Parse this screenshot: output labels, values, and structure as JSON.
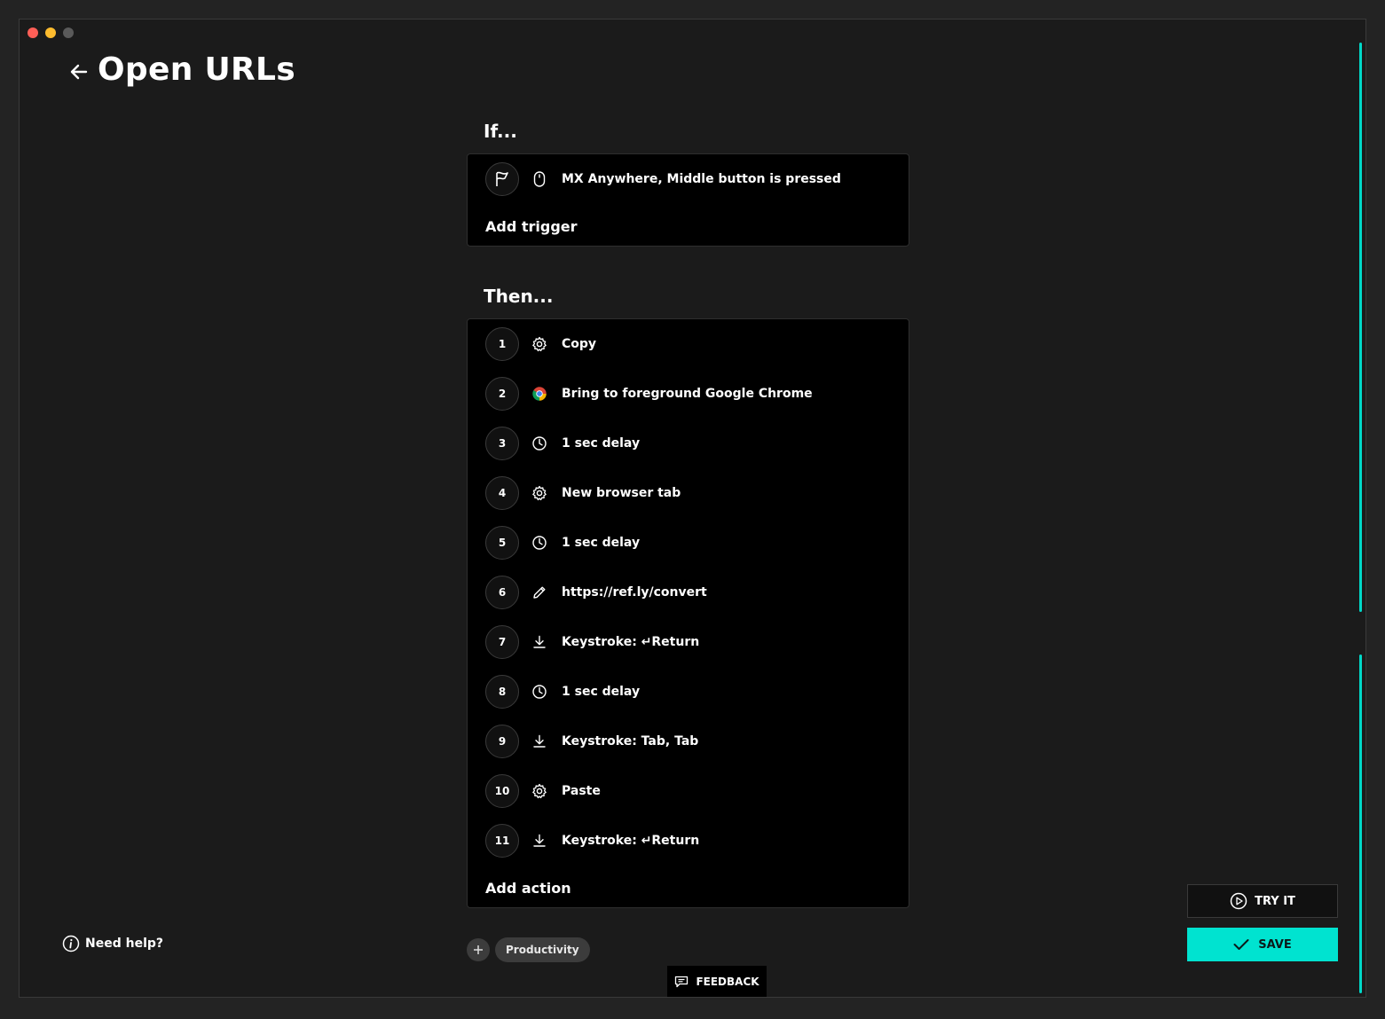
{
  "header": {
    "title": "Open URLs"
  },
  "if_section": {
    "label": "If...",
    "trigger": {
      "icon": "flag-icon",
      "device_icon": "mouse-icon",
      "text": "MX Anywhere, Middle button is pressed"
    },
    "add_trigger": "Add trigger"
  },
  "then_section": {
    "label": "Then...",
    "actions": [
      {
        "num": "1",
        "icon": "gear-icon",
        "text": "Copy"
      },
      {
        "num": "2",
        "icon": "chrome-icon",
        "text": "Bring to foreground Google Chrome"
      },
      {
        "num": "3",
        "icon": "clock-icon",
        "text": "1 sec delay"
      },
      {
        "num": "4",
        "icon": "gear-icon",
        "text": "New browser tab"
      },
      {
        "num": "5",
        "icon": "clock-icon",
        "text": "1 sec delay"
      },
      {
        "num": "6",
        "icon": "pencil-icon",
        "text": "https://ref.ly/convert"
      },
      {
        "num": "7",
        "icon": "download-icon",
        "text": "Keystroke: ↵Return"
      },
      {
        "num": "8",
        "icon": "clock-icon",
        "text": "1 sec delay"
      },
      {
        "num": "9",
        "icon": "download-icon",
        "text": "Keystroke: Tab, Tab"
      },
      {
        "num": "10",
        "icon": "gear-icon",
        "text": "Paste"
      },
      {
        "num": "11",
        "icon": "download-icon",
        "text": "Keystroke: ↵Return"
      }
    ],
    "add_action": "Add action"
  },
  "footer": {
    "help": "Need help?",
    "tag": "Productivity",
    "feedback": "FEEDBACK",
    "try_it": "TRY IT",
    "save": "SAVE"
  },
  "colors": {
    "accent": "#00e3d0",
    "background": "#1b1b1b",
    "card": "#000000"
  }
}
